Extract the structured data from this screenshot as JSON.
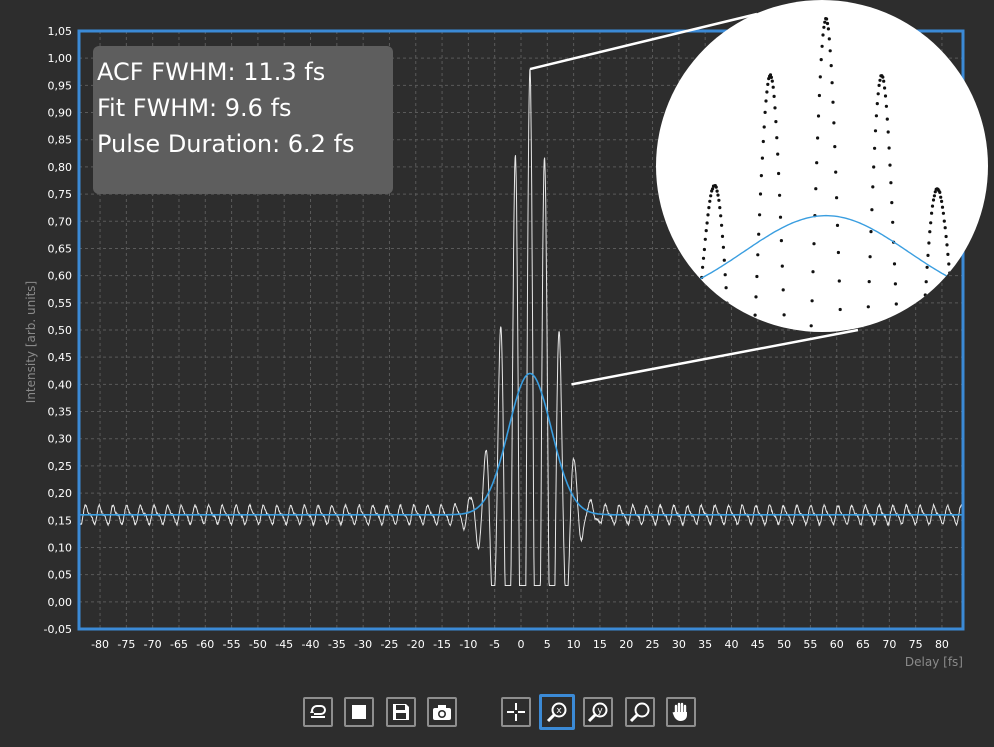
{
  "info": {
    "acf_fwhm": "ACF FWHM: 11.3 fs",
    "fit_fwhm": "Fit FWHM: 9.6 fs",
    "pulse_duration": "Pulse Duration: 6.2 fs"
  },
  "colors": {
    "background": "#2d2d2d",
    "plot_border": "#3b8ad6",
    "grid": "#5a5a5a",
    "acf_trace": "#e8e8e8",
    "fit_curve": "#3a9ee0",
    "active_button": "#3b8ad6"
  },
  "chart_data": {
    "type": "line",
    "xlabel": "Delay [fs]",
    "ylabel": "Intensity [arb. units]",
    "xlim": [
      -84,
      84
    ],
    "ylim": [
      -0.05,
      1.05
    ],
    "x_ticks": [
      -80,
      -75,
      -70,
      -65,
      -60,
      -55,
      -50,
      -45,
      -40,
      -35,
      -30,
      -25,
      -20,
      -15,
      -10,
      -5,
      0,
      5,
      10,
      15,
      20,
      25,
      30,
      35,
      40,
      45,
      50,
      55,
      60,
      65,
      70,
      75,
      80
    ],
    "y_tick_labels": [
      "-0,05",
      "0,00",
      "0,05",
      "0,10",
      "0,15",
      "0,20",
      "0,25",
      "0,30",
      "0,35",
      "0,40",
      "0,45",
      "0,50",
      "0,55",
      "0,60",
      "0,65",
      "0,70",
      "0,75",
      "0,80",
      "0,85",
      "0,90",
      "0,95",
      "1,00",
      "1,05"
    ],
    "grid": true,
    "series": [
      {
        "kind": "acf",
        "baseline": 0.16,
        "peak": 0.98,
        "center": 1.7,
        "period": 2.8,
        "envelope_width": 6.0
      },
      {
        "kind": "fit",
        "baseline": 0.16,
        "peak": 0.42,
        "center": 1.7,
        "fwhm": 9.6
      }
    ],
    "zoom_inset": {
      "x_range": [
        -7,
        10
      ],
      "source_points": [
        [
          1.7,
          0.98
        ],
        [
          9.6,
          0.4
        ]
      ]
    }
  },
  "toolbar": {
    "buttons": [
      {
        "name": "reset-button",
        "icon": "loop-icon",
        "active": true
      },
      {
        "name": "stop-button",
        "icon": "stop-icon",
        "active": true
      },
      {
        "name": "save-button",
        "icon": "floppy-icon",
        "active": false
      },
      {
        "name": "snapshot-button",
        "icon": "camera-icon",
        "active": false
      },
      {
        "name": "crosshair-button",
        "icon": "crosshair-icon",
        "active": false
      },
      {
        "name": "zoom-x-button",
        "icon": "zoom-x-icon",
        "active": true
      },
      {
        "name": "zoom-y-button",
        "icon": "zoom-y-icon",
        "active": false
      },
      {
        "name": "zoom-button",
        "icon": "zoom-icon",
        "active": false
      },
      {
        "name": "pan-button",
        "icon": "hand-icon",
        "active": false
      }
    ],
    "zoom_x_glyph": "x",
    "zoom_y_glyph": "y"
  }
}
